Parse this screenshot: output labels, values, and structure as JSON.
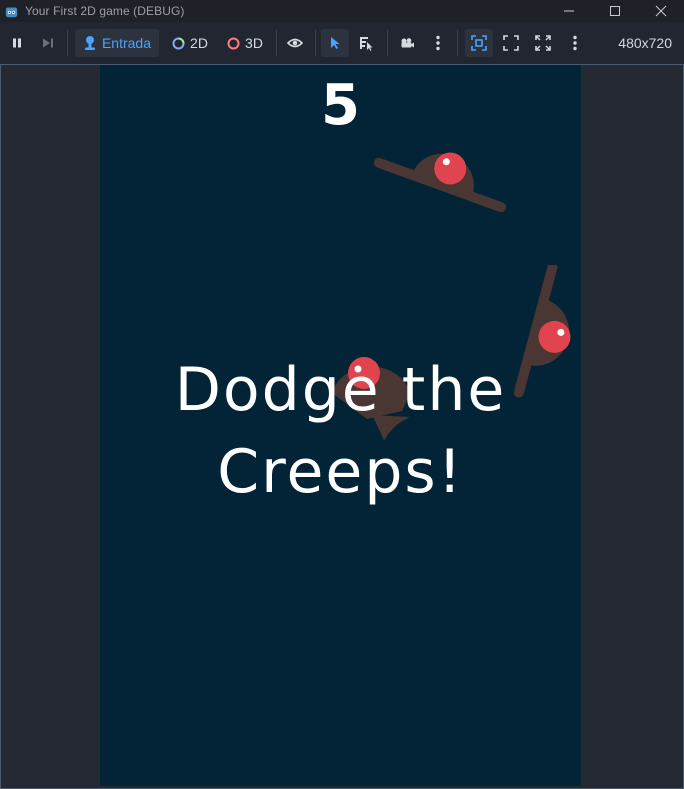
{
  "window": {
    "title": "Your First 2D game (DEBUG)"
  },
  "toolbar": {
    "input_label": "Entrada",
    "mode_2d_label": "2D",
    "mode_3d_label": "3D",
    "resolution": "480x720"
  },
  "game": {
    "score": "5",
    "message_line1": "Dodge the",
    "message_line2": "Creeps!"
  },
  "colors": {
    "game_background": "#032436",
    "creep_body": "#4a3632",
    "creep_eye": "#e0444e",
    "accent": "#4aa3ff"
  }
}
